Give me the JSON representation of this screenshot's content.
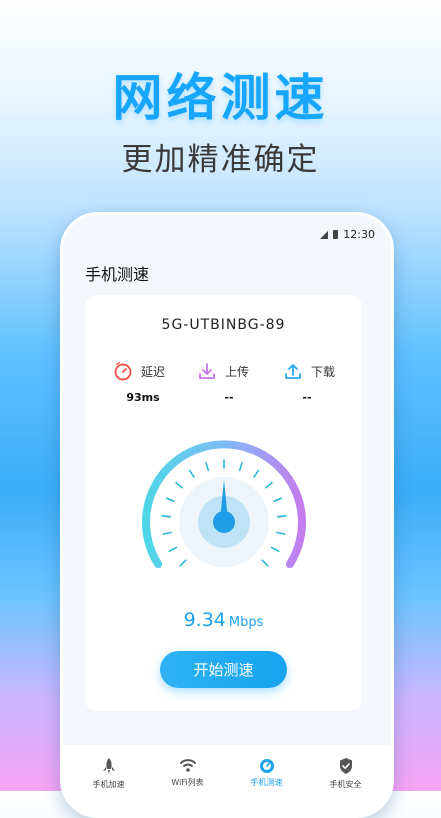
{
  "promo": {
    "title": "网络测速",
    "subtitle": "更加精准确定"
  },
  "status": {
    "time": "12:30"
  },
  "app": {
    "title": "手机测速"
  },
  "network": {
    "ssid": "5G-UTBINBG-89"
  },
  "metrics": [
    {
      "icon": "timer-icon",
      "label": "延迟",
      "value": "93ms"
    },
    {
      "icon": "upload-icon",
      "label": "上传",
      "value": "--"
    },
    {
      "icon": "download-icon",
      "label": "下载",
      "value": "--"
    }
  ],
  "speed": {
    "value": "9.34",
    "unit": "Mbps"
  },
  "button": {
    "start_label": "开始测速"
  },
  "tabs": [
    {
      "icon": "rocket-icon",
      "label": "手机加速",
      "active": false
    },
    {
      "icon": "wifi-icon",
      "label": "WiFi列表",
      "active": false
    },
    {
      "icon": "speedometer-icon",
      "label": "手机测速",
      "active": true
    },
    {
      "icon": "shield-icon",
      "label": "手机安全",
      "active": false
    }
  ],
  "colors": {
    "accent": "#1aa3ee",
    "gauge_start": "#4fd6e6",
    "gauge_end": "#c47df0"
  }
}
